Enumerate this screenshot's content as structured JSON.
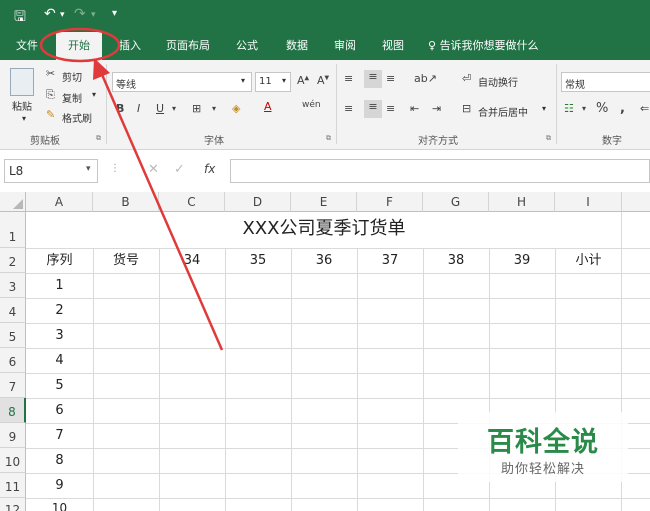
{
  "quick_access": {
    "more": "▾"
  },
  "tabs": [
    "文件",
    "开始",
    "插入",
    "页面布局",
    "公式",
    "数据",
    "审阅",
    "视图"
  ],
  "tell_me": "告诉我你想要做什么",
  "clipboard": {
    "paste": "粘贴",
    "cut": "剪切",
    "copy": "复制",
    "format_painter": "格式刷",
    "group": "剪贴板"
  },
  "font": {
    "name": "等线",
    "size": "11",
    "group": "字体"
  },
  "alignment": {
    "wrap": "自动换行",
    "merge": "合并后居中",
    "group": "对齐方式"
  },
  "number": {
    "format": "常规",
    "group": "数字"
  },
  "name_box": "L8",
  "columns": [
    "A",
    "B",
    "C",
    "D",
    "E",
    "F",
    "G",
    "H",
    "I"
  ],
  "rows": [
    "1",
    "2",
    "3",
    "4",
    "5",
    "6",
    "7",
    "8",
    "9",
    "10",
    "11",
    "12"
  ],
  "sheet": {
    "title": "XXX公司夏季订货单",
    "header": [
      "序列",
      "货号",
      "34",
      "35",
      "36",
      "37",
      "38",
      "39",
      "小计"
    ],
    "serials": [
      "1",
      "2",
      "3",
      "4",
      "5",
      "6",
      "7",
      "8",
      "9",
      "10"
    ]
  },
  "watermark": {
    "title": "百科全说",
    "subtitle": "助你轻松解决"
  },
  "annotation_color": "#e03a3a",
  "accent": "#217346"
}
